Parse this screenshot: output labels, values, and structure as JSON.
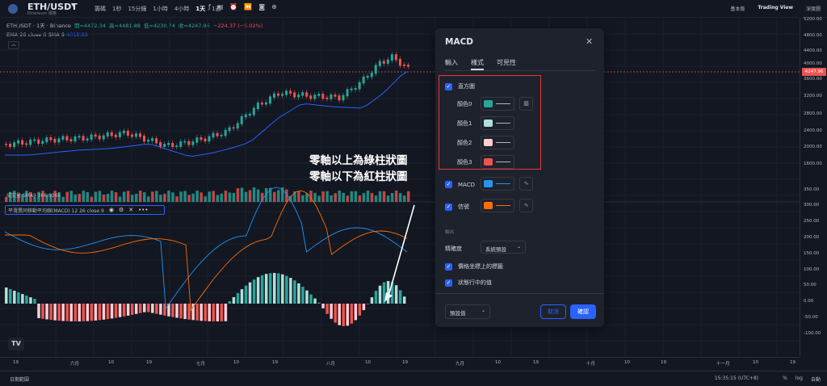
{
  "header": {
    "symbol": "ETH/USDT",
    "symbol_dropdown": "▾",
    "symbol_sub": "Ethereum 價格",
    "timeframes": [
      "籌碼",
      "1秒",
      "15分鐘",
      "1小時",
      "4小時",
      "1天",
      "1週"
    ],
    "active_timeframe": "1天",
    "icons": [
      "indicators-icon",
      "layout-icon",
      "alert-icon",
      "replay-icon",
      "camera-icon",
      "add-icon"
    ],
    "right": [
      "基本版",
      "Trading View",
      "深度圖"
    ]
  },
  "info": {
    "title": "ETHUSDT · 1天 · Binance",
    "o": "開=4472.34",
    "h": "高=4481.88",
    "l": "低=4230.74",
    "c": "收=4247.96",
    "chg": "−224.37 (−5.02%)"
  },
  "ema": {
    "label": "EMA 26 close 0 SMA 9",
    "value": "4018.89"
  },
  "collapse_glyph": "︿",
  "volume_label": "成交量 SMA9  366.936k",
  "macd_indicator": {
    "label": "平滑異同移動平均線(MACD) 12 26 close 9",
    "icons": [
      "eye-icon",
      "settings-icon",
      "close-icon",
      "more-icon"
    ],
    "more": "•••",
    "close": "✕"
  },
  "tv_logo": "TV",
  "yaxis": [
    "5200.00",
    "4800.00",
    "4400.00",
    "4000.00",
    "3600.00",
    "3200.00",
    "2800.00",
    "2400.00",
    "2000.00",
    "1600.00",
    "350.00",
    "300.00",
    "250.00",
    "200.00",
    "150.00",
    "100.00",
    "50.00",
    "0.00",
    "-50.00",
    "-100.00"
  ],
  "price_tag": "4247.96",
  "xaxis": [
    "19",
    "六月",
    "10",
    "19",
    "七月",
    "10",
    "19",
    "八月",
    "10",
    "19",
    "九月",
    "10",
    "19",
    "十月",
    "10",
    "19",
    "十一月",
    "10",
    "19"
  ],
  "bottom": {
    "left": "日期範圍",
    "time": "15:35:15 (UTC+8)",
    "pct": "%",
    "log": "log",
    "auto": "自動"
  },
  "annotation": {
    "line1": "零軸以上為綠柱狀圖",
    "line2": "零軸以下為紅柱狀圖"
  },
  "modal": {
    "title": "MACD",
    "close": "✕",
    "tabs": [
      "輸入",
      "樣式",
      "可見性"
    ],
    "active_tab": "樣式",
    "histogram": {
      "label": "直方圖",
      "colors": [
        {
          "label": "顏色0",
          "color": "#26a69a"
        },
        {
          "label": "顏色1",
          "color": "#b2dfdb"
        },
        {
          "label": "顏色2",
          "color": "#ffcdd2"
        },
        {
          "label": "顏色3",
          "color": "#ef5350"
        }
      ]
    },
    "macd": {
      "label": "MACD",
      "color": "#2196f3"
    },
    "signal": {
      "label": "信號",
      "color": "#ff6d00"
    },
    "section": "輸出",
    "precision_label": "精確度",
    "precision_value": "系統預設",
    "opt1": "價格坐標上的標籤",
    "opt2": "狀態行中的值",
    "preset": "預設值",
    "cancel": "取消",
    "ok": "確認",
    "check": "✓",
    "chevron": "⌄"
  }
}
